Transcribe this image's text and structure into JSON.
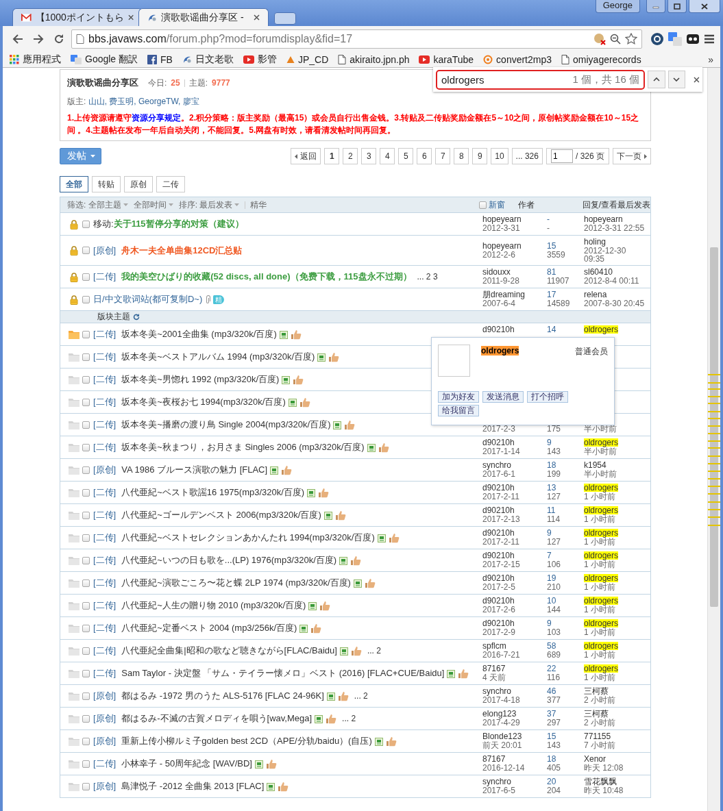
{
  "browser": {
    "tabs": [
      {
        "kind": "mail",
        "title": "【1000ポイントもら",
        "selected": false
      },
      {
        "kind": "forum",
        "title": "演歌歌谣曲分享区 - ",
        "selected": true
      }
    ],
    "profile": "George",
    "url_host": "bbs.javaws.com",
    "url_path": "/forum.php?mod=forumdisplay&fid=17",
    "bookmarks": [
      {
        "kind": "apps",
        "label": "應用程式"
      },
      {
        "kind": "translate",
        "label": "Google 翻訳"
      },
      {
        "kind": "facebook",
        "label": "FB"
      },
      {
        "kind": "forum",
        "label": "日文老歌"
      },
      {
        "kind": "video",
        "label": "影管"
      },
      {
        "kind": "triangle",
        "label": "JP_CD"
      },
      {
        "kind": "page",
        "label": "akiraito.jpn.ph"
      },
      {
        "kind": "video",
        "label": "karaTube"
      },
      {
        "kind": "ring",
        "label": "convert2mp3"
      },
      {
        "kind": "page",
        "label": "omiyagerecords"
      }
    ],
    "bookmarks_more": "»"
  },
  "find_bar": {
    "query": "oldrogers",
    "count": "1 個，共 16 個"
  },
  "forum": {
    "title": "演歌歌谣曲分享区",
    "today_label": "今日:",
    "today": "25",
    "topics_label": "主题:",
    "topics": "9777",
    "moderators_label": "版主:",
    "moderators": "山山, 费玉明, GeorgeTW, 廖宝",
    "notice_before": "1.上传资源请遵守",
    "notice_link": "资源分享规定",
    "notice_after": "。2.积分策略：版主奖励（最高15）或会员自行出售金钱。3.转贴及二传贴奖励金额在5～10之间，原创帖奖励金额在10～15之间 。4.主题帖在发布一年后自动关闭，不能回复。5.网盘有时效，请看清发帖时间再回复。"
  },
  "post_button": "发帖",
  "pagination": {
    "back": "返回",
    "pages": [
      {
        "label": "1",
        "selected": true
      },
      {
        "label": "2",
        "selected": false
      },
      {
        "label": "3",
        "selected": false
      },
      {
        "label": "4",
        "selected": false
      },
      {
        "label": "5",
        "selected": false
      },
      {
        "label": "6",
        "selected": false
      },
      {
        "label": "7",
        "selected": false
      },
      {
        "label": "8",
        "selected": false
      },
      {
        "label": "9",
        "selected": false
      },
      {
        "label": "10",
        "selected": false
      },
      {
        "label": "... 326",
        "selected": false
      }
    ],
    "page_input": "1",
    "total": "/ 326 页",
    "next": "下一页"
  },
  "type_tabs": [
    {
      "label": "全部",
      "selected": true
    },
    {
      "label": "转贴",
      "selected": false
    },
    {
      "label": "原创",
      "selected": false
    },
    {
      "label": "二传",
      "selected": false
    }
  ],
  "table_header": {
    "filter_label": "筛选:",
    "filter_type": "全部主题",
    "filter_time": "全部时间",
    "sort_label": "排序:",
    "sort": "最后发表",
    "digest": "精华",
    "new_window": "新窗",
    "new_window_checked": false,
    "author": "作者",
    "replies": "回复/查看",
    "last_post": "最后发表"
  },
  "sticky_threads": [
    {
      "kind": "green",
      "locked": true,
      "checked": false,
      "moved_label": "移动:",
      "title": "关于115暂停分享的对策（建议）",
      "author": "hopeyearn",
      "date": "2012-3-31",
      "replies": "-",
      "views": "-",
      "last_user": "hopeyearn",
      "highlighted": false,
      "last_time": "2012-3-31 22:55"
    },
    {
      "kind": "red",
      "locked": true,
      "checked": false,
      "tag": "[原创]",
      "title": "舟木一夫全单曲集12CD汇总贴",
      "author": "hopeyearn",
      "date": "2012-2-6",
      "replies": "15",
      "views": "3559",
      "last_user": "holing",
      "highlighted": false,
      "last_time": "2012-12-30 09:35"
    },
    {
      "kind": "green",
      "locked": true,
      "checked": false,
      "tag": "[二传]",
      "title": "我的美空ひばり的收藏(52 discs, all done)（免费下载，115盘永不过期）",
      "pages": "... 2 3",
      "author": "sidouxx",
      "date": "2011-9-28",
      "replies": "81",
      "views": "11907",
      "last_user": "sl60410",
      "highlighted": false,
      "last_time": "2012-8-4 00:11"
    },
    {
      "kind": "link",
      "locked": true,
      "checked": false,
      "title": "日/中文歌词站(都可复制D~)",
      "clip": true,
      "badge": "精",
      "author": "朋dreaming",
      "date": "2007-6-4",
      "replies": "17",
      "views": "14589",
      "last_user": "relena",
      "highlighted": false,
      "last_time": "2007-8-30 20:45"
    }
  ],
  "section_label": "版块主题",
  "threads": [
    {
      "kind": "plain",
      "unread": true,
      "checked": false,
      "tag": "[二传]",
      "title": "坂本冬美~2001全曲集 (mp3/320k/百度)",
      "image": true,
      "thumb": true,
      "author": "d90210h",
      "replies": "14",
      "last_user": "oldrogers",
      "highlighted": true
    },
    {
      "kind": "plain",
      "unread": false,
      "checked": false,
      "tag": "[二传]",
      "title": "坂本冬美~ベストアルバム 1994 (mp3/320k/百度)",
      "image": true,
      "thumb": true
    },
    {
      "kind": "plain",
      "unread": false,
      "checked": false,
      "tag": "[二传]",
      "title": "坂本冬美~男惚れ 1992 (mp3/320k/百度)",
      "image": true,
      "thumb": true
    },
    {
      "kind": "plain",
      "unread": false,
      "checked": false,
      "tag": "[二传]",
      "title": "坂本冬美~夜桜お七 1994(mp3/320k/百度)",
      "image": true,
      "thumb": true
    },
    {
      "kind": "plain",
      "unread": false,
      "checked": false,
      "tag": "[二传]",
      "title": "坂本冬美~播磨の渡り鳥 Single 2004(mp3/320k/百度)",
      "image": true,
      "thumb": true,
      "date": "2017-2-3",
      "views": "175",
      "last_time": "半小时前"
    },
    {
      "kind": "plain",
      "unread": false,
      "checked": false,
      "tag": "[二传]",
      "title": "坂本冬美~秋まつり，お月さま Singles 2006 (mp3/320k/百度)",
      "image": true,
      "thumb": true,
      "author": "d90210h",
      "date": "2017-1-14",
      "replies": "9",
      "views": "143",
      "last_user": "oldrogers",
      "highlighted": true,
      "last_time": "半小时前"
    },
    {
      "kind": "plain",
      "unread": false,
      "checked": false,
      "tag": "[原创]",
      "title": "VA 1986 ブルース演歌の魅力 [FLAC]",
      "image": true,
      "thumb": true,
      "author": "synchro",
      "date": "2017-6-1",
      "replies": "18",
      "views": "199",
      "last_user": "k1954",
      "highlighted": false,
      "last_time": "半小时前"
    },
    {
      "kind": "plain",
      "unread": false,
      "checked": false,
      "tag": "[二传]",
      "title": "八代亜紀~ベスト歌謡16 1975(mp3/320k/百度)",
      "image": true,
      "thumb": true,
      "author": "d90210h",
      "date": "2017-2-11",
      "replies": "13",
      "views": "127",
      "last_user": "oldrogers",
      "highlighted": true,
      "last_time": "1 小时前"
    },
    {
      "kind": "plain",
      "unread": false,
      "checked": false,
      "tag": "[二传]",
      "title": "八代亜紀~ゴールデンベスト 2006(mp3/320k/百度)",
      "image": true,
      "thumb": true,
      "author": "d90210h",
      "date": "2017-2-13",
      "replies": "11",
      "views": "114",
      "last_user": "oldrogers",
      "highlighted": true,
      "last_time": "1 小时前"
    },
    {
      "kind": "plain",
      "unread": false,
      "checked": false,
      "tag": "[二传]",
      "title": "八代亜紀~ベストセレクションあかんたれ 1994(mp3/320k/百度)",
      "image": true,
      "thumb": true,
      "author": "d90210h",
      "date": "2017-2-11",
      "replies": "9",
      "views": "127",
      "last_user": "oldrogers",
      "highlighted": true,
      "last_time": "1 小时前"
    },
    {
      "kind": "plain",
      "unread": false,
      "checked": false,
      "tag": "[二传]",
      "title": "八代亜紀~いつの日も歌を...(LP) 1976(mp3/320k/百度)",
      "image": true,
      "thumb": true,
      "author": "d90210h",
      "date": "2017-2-15",
      "replies": "7",
      "views": "106",
      "last_user": "oldrogers",
      "highlighted": true,
      "last_time": "1 小时前"
    },
    {
      "kind": "plain",
      "unread": false,
      "checked": false,
      "tag": "[二传]",
      "title": "八代亜紀~演歌ごころ〜花と蝶 2LP 1974 (mp3/320k/百度)",
      "image": true,
      "thumb": true,
      "author": "d90210h",
      "date": "2017-2-5",
      "replies": "19",
      "views": "210",
      "last_user": "oldrogers",
      "highlighted": true,
      "last_time": "1 小时前"
    },
    {
      "kind": "plain",
      "unread": false,
      "checked": false,
      "tag": "[二传]",
      "title": "八代亜紀~人生の贈り物 2010 (mp3/320k/百度)",
      "image": true,
      "thumb": true,
      "author": "d90210h",
      "date": "2017-2-6",
      "replies": "10",
      "views": "144",
      "last_user": "oldrogers",
      "highlighted": true,
      "last_time": "1 小时前"
    },
    {
      "kind": "plain",
      "unread": false,
      "checked": false,
      "tag": "[二传]",
      "title": "八代亜紀~定番ベスト 2004 (mp3/256k/百度)",
      "image": true,
      "thumb": true,
      "author": "d90210h",
      "date": "2017-2-9",
      "replies": "9",
      "views": "103",
      "last_user": "oldrogers",
      "highlighted": true,
      "last_time": "1 小时前"
    },
    {
      "kind": "plain",
      "unread": false,
      "checked": false,
      "tag": "[二传]",
      "title": "八代亜紀全曲集|昭和の歌など聴きながら[FLAC/Baidu]",
      "image": true,
      "thumb": true,
      "pages": "... 2",
      "author": "spflcm",
      "date": "2016-7-21",
      "replies": "58",
      "views": "689",
      "last_user": "oldrogers",
      "highlighted": true,
      "last_time": "1 小时前"
    },
    {
      "kind": "plain",
      "unread": false,
      "checked": false,
      "tag": "[二传]",
      "title": "Sam Taylor - 決定盤 「サム・テイラー懐メロ」ベスト (2016) [FLAC+CUE/Baidu]",
      "image": true,
      "thumb": true,
      "author": "87167",
      "date": "4 天前",
      "replies": "22",
      "views": "116",
      "last_user": "oldrogers",
      "highlighted": true,
      "last_time": "1 小时前"
    },
    {
      "kind": "plain",
      "unread": false,
      "checked": false,
      "tag": "[原创]",
      "title": "都はるみ -1972 男のうた ALS-5176 [FLAC 24-96K]",
      "image": true,
      "thumb": true,
      "pages": "... 2",
      "author": "synchro",
      "date": "2017-4-18",
      "replies": "46",
      "views": "377",
      "last_user": "三柯蔡",
      "highlighted": false,
      "last_time": "2 小时前"
    },
    {
      "kind": "plain",
      "unread": false,
      "checked": false,
      "tag": "[原创]",
      "title": "都はるみ-不滅の古賀メロディを唄う[wav,Mega]",
      "image": true,
      "thumb": true,
      "pages": "... 2",
      "author": "elong123",
      "date": "2017-4-29",
      "replies": "37",
      "views": "297",
      "last_user": "三柯蔡",
      "highlighted": false,
      "last_time": "2 小时前"
    },
    {
      "kind": "plain",
      "unread": false,
      "checked": false,
      "tag": "[原创]",
      "title": "重新上传小柳ルミ子golden best 2CD（APE/分轨/baidu）(自压)",
      "image": true,
      "thumb": true,
      "author": "Blonde123",
      "date": "前天 20:01",
      "replies": "15",
      "views": "143",
      "last_user": "771155",
      "highlighted": false,
      "last_time": "7 小时前"
    },
    {
      "kind": "plain",
      "unread": false,
      "checked": false,
      "tag": "[二传]",
      "title": "小林幸子 - 50周年紀念 [WAV/BD]",
      "image": true,
      "thumb": true,
      "author": "87167",
      "date": "2016-12-14",
      "replies": "18",
      "views": "405",
      "last_user": "Xenor",
      "highlighted": false,
      "last_time": "昨天 12:08"
    },
    {
      "kind": "plain",
      "unread": false,
      "checked": false,
      "tag": "[原创]",
      "title": "島津悦子 -2012 全曲集 2013 [FLAC]",
      "image": true,
      "thumb": true,
      "author": "synchro",
      "date": "2017-6-5",
      "replies": "20",
      "views": "204",
      "last_user": "雪花飘飘",
      "highlighted": false,
      "last_time": "昨天 10:48"
    }
  ],
  "user_popup": {
    "username": "oldrogers",
    "highlighted": true,
    "group": "普通会员",
    "buttons": [
      "加为好友",
      "发送消息",
      "打个招呼",
      "给我留言"
    ]
  }
}
